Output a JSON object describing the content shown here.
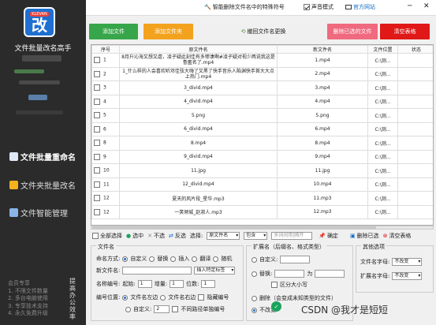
{
  "sidebar": {
    "logo_tag": "KLEVAN",
    "logo_glyph": "改",
    "app_name": "文件批量改名高手",
    "nav": [
      {
        "label": "文件批量重命名",
        "icon": "file-rename-icon"
      },
      {
        "label": "文件夹批量改名",
        "icon": "folder-icon"
      },
      {
        "label": "文件智能管理",
        "icon": "folder-manage-icon"
      }
    ],
    "promo": [
      "会员专享",
      "1. 不限文件数量",
      "2. 多台电脑使用",
      "3. 专享技术支持",
      "4. 永久免费升级"
    ],
    "vertical_text": "提高办公效率"
  },
  "topbar": {
    "remove_special": "智能删除文件名中的特殊符号",
    "sound_mode": "声音模式",
    "website": "官方网站"
  },
  "toolbar": {
    "add_file": "添加文件",
    "add_folder": "添加文件夹",
    "restore": "撤回文件名更换",
    "delete_selected": "删除已选的文件",
    "clear_table": "清空表格",
    "colors": {
      "add_file": "#37a64a",
      "add_folder": "#f3a21e",
      "delete_selected": "#ef6a7e",
      "clear_table": "#e01818"
    }
  },
  "table": {
    "headers": [
      "序号",
      "原文件名",
      "新文件名",
      "文件位置",
      "状态"
    ],
    "rows": [
      {
        "seq": "1",
        "old": "8月升沁海又想又虐，凌子疑此刻佳有多惨凄啊#凌子疑对视少两说我这是鲁匿名了.mp4",
        "new": "1.mp4",
        "path": "C:\\测..."
      },
      {
        "seq": "2",
        "old": "1_什么样的人会喜欢听邓佳弦大嗨了又黑了快手音乐人陷渊快手首大大点上热门.mp4",
        "new": "2.mp4",
        "path": "C:\\测..."
      },
      {
        "seq": "3",
        "old": "3_divid.mp4",
        "new": "3.mp4",
        "path": "C:\\测..."
      },
      {
        "seq": "4",
        "old": "4_divid.mp4",
        "new": "4.mp4",
        "path": "C:\\测..."
      },
      {
        "seq": "5",
        "old": "5.png",
        "new": "5.png",
        "path": "C:\\测..."
      },
      {
        "seq": "6",
        "old": "6_divid.mp4",
        "new": "6.mp4",
        "path": "C:\\测..."
      },
      {
        "seq": "8",
        "old": "8.mp4",
        "new": "8.mp4",
        "path": "C:\\测..."
      },
      {
        "seq": "9",
        "old": "9_divid.mp4",
        "new": "9.mp4",
        "path": "C:\\测..."
      },
      {
        "seq": "10",
        "old": "11.jpg",
        "new": "11.jpg",
        "path": "C:\\测..."
      },
      {
        "seq": "11",
        "old": "12_divid.mp4",
        "new": "10.mp4",
        "path": "C:\\测..."
      },
      {
        "seq": "12",
        "old": "夏天的风片段_星华.mp3",
        "new": "11.mp3",
        "path": "C:\\测..."
      },
      {
        "seq": "12",
        "old": "一笑倾城_赵淑人.mp3",
        "new": "12.mp3",
        "path": "C:\\测..."
      }
    ]
  },
  "selection": {
    "select_all": "全部选择",
    "select": "选中",
    "unselect": "不选",
    "invert": "反选",
    "select_label": "选择:",
    "field": "原文件名",
    "mode": "包含",
    "placeholder": "多词间用|隔开",
    "confirm": "确定",
    "delete_selected": "删除已选",
    "clear_table": "清空表格"
  },
  "filename_group": {
    "title": "文件名",
    "naming_method_label": "命名方式:",
    "naming_options": [
      "自定义",
      "替换",
      "插入",
      "翻译",
      "随机"
    ],
    "new_name_label": "新文件名:",
    "insert_special": "插入特定标签",
    "numbering_label": "名称编号:",
    "start_label": "起始:",
    "start_value": "1",
    "step_label": "增量:",
    "step_value": "1",
    "digits_label": "位数:",
    "digits_value": "1",
    "position_label": "编号位置:",
    "pos_left": "文件名左边",
    "pos_right": "文件名右边",
    "hide_number": "隐藏编号",
    "custom": "自定义:",
    "custom_value": "2",
    "no_number_same": "不同路径单独编号"
  },
  "ext_group": {
    "title": "扩展名（后缀名、格式类型）",
    "custom": "自定义:",
    "replace": "替换:",
    "as": "为",
    "case": "区分大小写",
    "delete": "删除（会变成未知类型的文件）",
    "unchanged": "不改变"
  },
  "other_group": {
    "title": "其他选项",
    "name_case_label": "文件名字母:",
    "name_case": "不改变",
    "ext_case_label": "扩展名字母:",
    "ext_case": "不改变"
  },
  "watermark": "CSDN @我才是短短"
}
